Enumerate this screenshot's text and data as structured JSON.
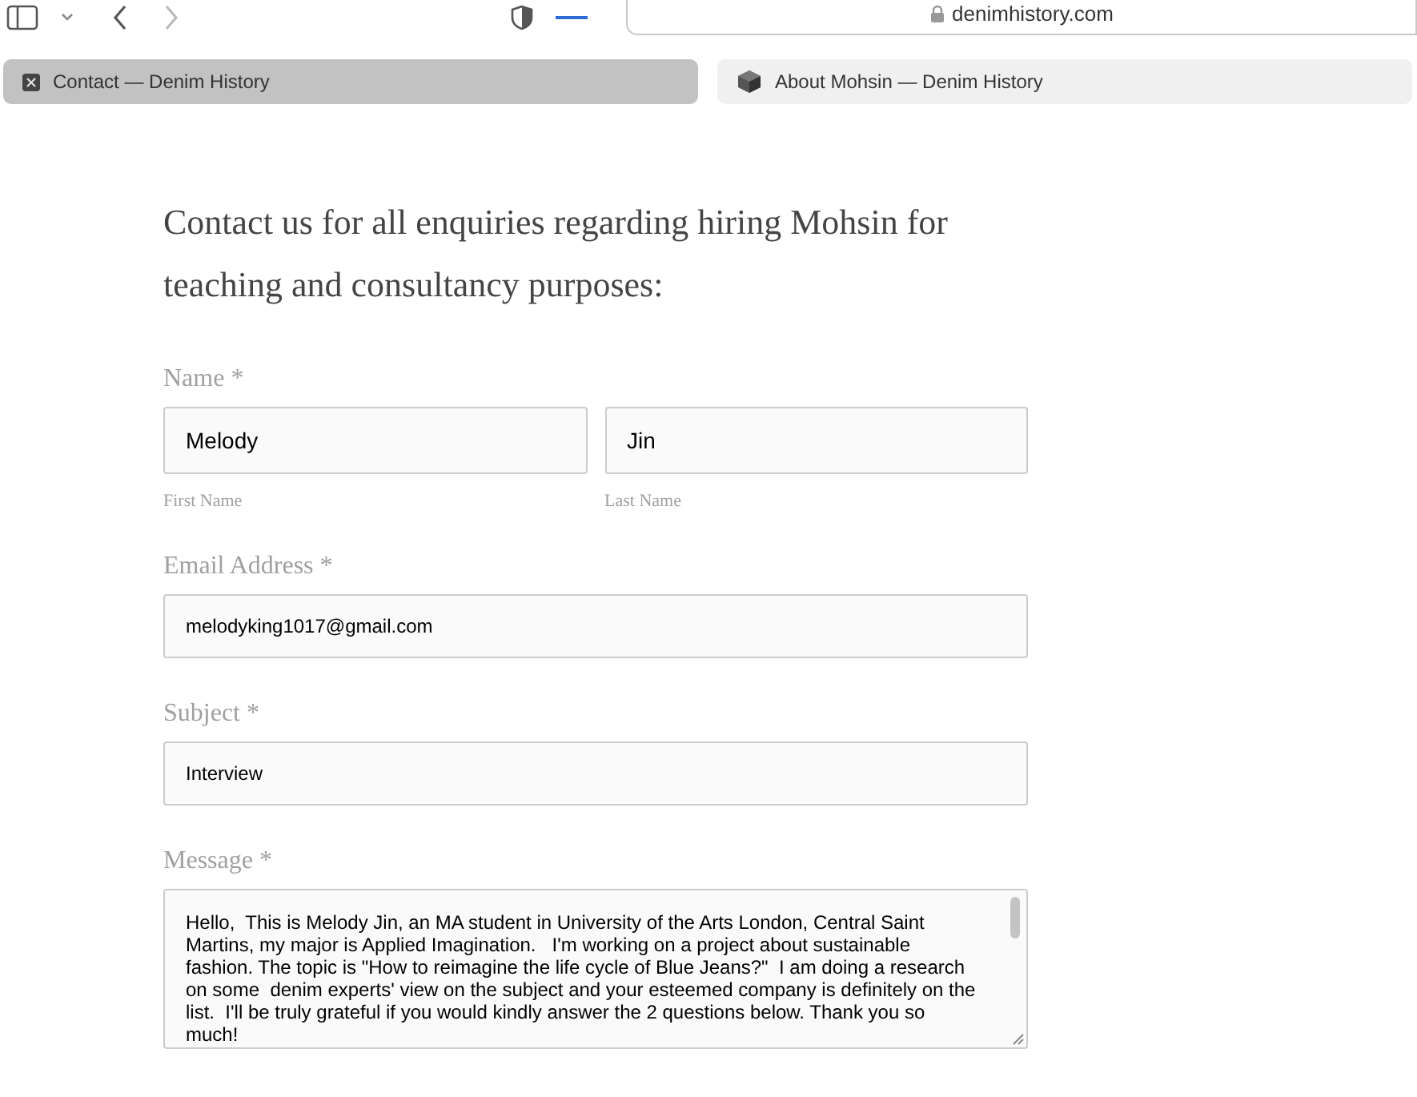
{
  "toolbar": {
    "url": "denimhistory.com"
  },
  "tabs": [
    {
      "label": "Contact — Denim History",
      "selected": true
    },
    {
      "label": "About Mohsin — Denim History",
      "selected": false
    }
  ],
  "heading": "Contact us for all enquiries regarding hiring Mohsin for teaching and consultancy purposes:",
  "form": {
    "name": {
      "label": "Name *",
      "first": {
        "value": "Melody",
        "caption": "First Name"
      },
      "last": {
        "value": "Jin",
        "caption": "Last Name"
      }
    },
    "fields": [
      {
        "label": "Email Address *",
        "value": "melodyking1017@gmail.com"
      },
      {
        "label": "Subject *",
        "value": "Interview"
      }
    ],
    "message": {
      "label": "Message *",
      "value": "Hello,  This is Melody Jin, an MA student in University of the Arts London, Central Saint Martins, my major is Applied Imagination.   I'm working on a project about sustainable fashion. The topic is \"How to reimagine the life cycle of Blue Jeans?\"  I am doing a research on some  denim experts' view on the subject and your esteemed company is definitely on the list.  I'll be truly grateful if you would kindly answer the 2 questions below. Thank you so much!"
    }
  }
}
